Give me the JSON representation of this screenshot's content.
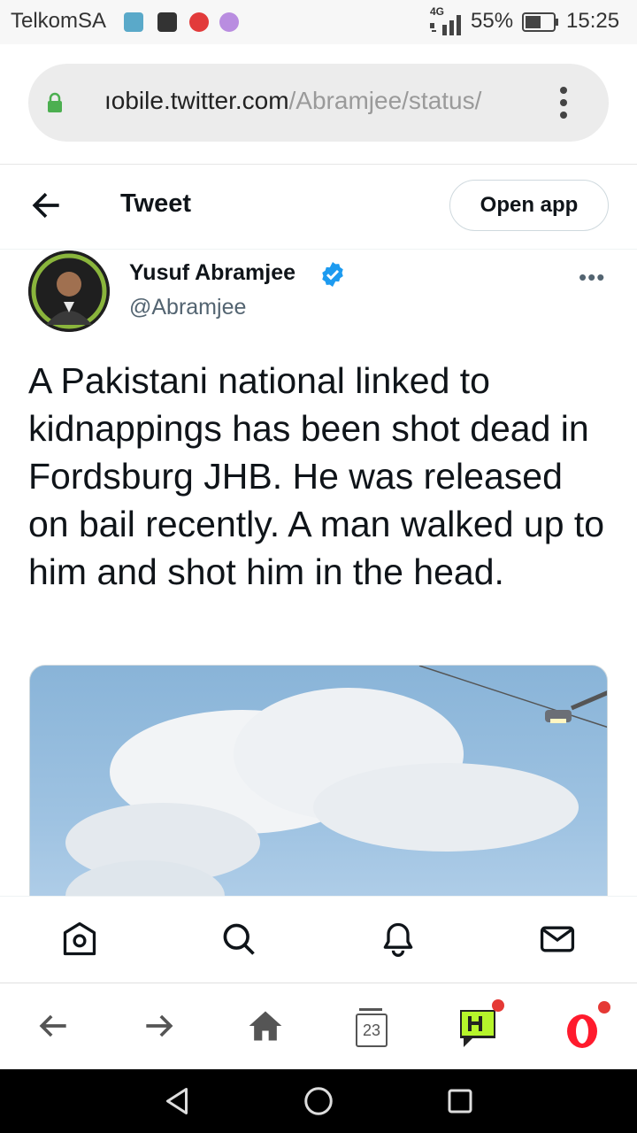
{
  "status_bar": {
    "carrier": "TelkomSA",
    "network": "4G",
    "battery": "55%",
    "time": "15:25"
  },
  "browser": {
    "url_host": "mobile.twitter.com",
    "url_path": "/Abramjee/status/",
    "url_display_host": "ıobile.twitter.com"
  },
  "header": {
    "title": "Tweet",
    "open_app_label": "Open app"
  },
  "tweet": {
    "author_name": "Yusuf Abramjee",
    "author_handle": "@Abramjee",
    "verified": true,
    "text": "A Pakistani national linked to kidnappings has been shot dead in Fordsburg JHB. He was released on bail recently. A man walked up to him and shot him in the head."
  },
  "browser_toolbar": {
    "tabs_count": "23"
  },
  "colors": {
    "twitter_blue": "#1d9bf0",
    "opera_red": "#ff1b2d",
    "badge_red": "#e53935"
  }
}
